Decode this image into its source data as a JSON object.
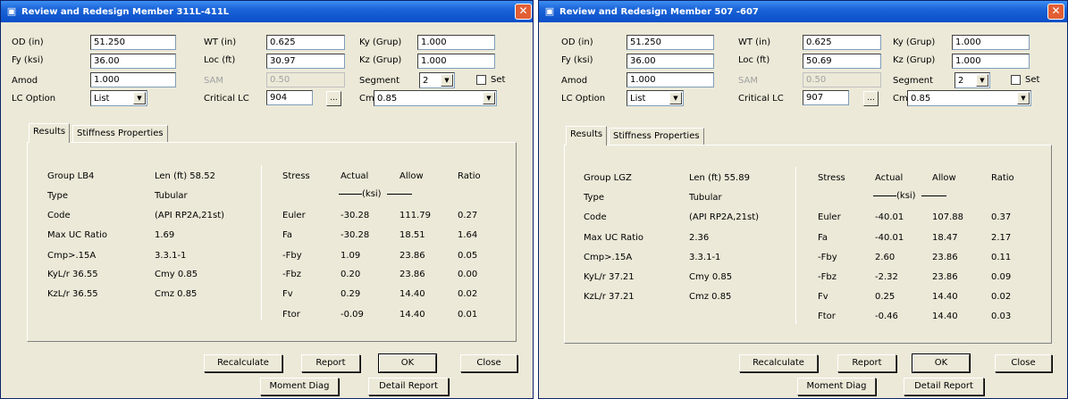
{
  "windows": [
    {
      "title": "Review and Redesign Member 311L-411L",
      "labels": {
        "od": "OD (in)",
        "fy": "Fy (ksi)",
        "amod": "Amod",
        "lc_option": "LC Option",
        "wt": "WT (in)",
        "loc": "Loc (ft)",
        "sam": "SAM",
        "critical_lc": "Critical LC",
        "ky": "Ky (Grup)",
        "kz": "Kz (Grup)",
        "segment": "Segment",
        "set": "Set",
        "cm": "Cm"
      },
      "values": {
        "od": "51.250",
        "fy": "36.00",
        "amod": "1.000",
        "lc_option": "List",
        "wt": "0.625",
        "loc": "30.97",
        "sam": "0.50",
        "critical_lc": "904",
        "ky": "1.000",
        "kz": "1.000",
        "segment": "2",
        "cm": "0.85",
        "ellipsis": "..."
      },
      "tabs": [
        "Results",
        "Stiffness Properties"
      ],
      "left_info": [
        [
          "Group LB4",
          "Len (ft) 58.52"
        ],
        [
          "Type",
          "Tubular"
        ],
        [
          "Code",
          "(API RP2A,21st)"
        ],
        [
          "Max UC Ratio",
          "1.69"
        ],
        [
          "Cmp>.15A",
          "3.3.1-1"
        ],
        [
          "KyL/r  36.55",
          "Cmy  0.85"
        ],
        [
          "KzL/r  36.55",
          "Cmz  0.85"
        ]
      ],
      "stress_headers": [
        "Stress",
        "Actual",
        "Allow",
        "Ratio"
      ],
      "ksi": "(ksi)",
      "stress_rows": [
        [
          "Euler",
          "-30.28",
          "111.79",
          "0.27"
        ],
        [
          "Fa",
          "-30.28",
          "18.51",
          "1.64"
        ],
        [
          "-Fby",
          "1.09",
          "23.86",
          "0.05"
        ],
        [
          "-Fbz",
          "0.20",
          "23.86",
          "0.00"
        ],
        [
          "Fv",
          "0.29",
          "14.40",
          "0.02"
        ],
        [
          "Ftor",
          "-0.09",
          "14.40",
          "0.01"
        ]
      ],
      "buttons": {
        "recalculate": "Recalculate",
        "report": "Report",
        "ok": "OK",
        "close": "Close",
        "moment_diag": "Moment Diag",
        "detail_report": "Detail Report"
      }
    },
    {
      "title": "Review and Redesign Member 507 -607",
      "labels": {
        "od": "OD (in)",
        "fy": "Fy (ksi)",
        "amod": "Amod",
        "lc_option": "LC Option",
        "wt": "WT (in)",
        "loc": "Loc (ft)",
        "sam": "SAM",
        "critical_lc": "Critical LC",
        "ky": "Ky (Grup)",
        "kz": "Kz (Grup)",
        "segment": "Segment",
        "set": "Set",
        "cm": "Cm"
      },
      "values": {
        "od": "51.250",
        "fy": "36.00",
        "amod": "1.000",
        "lc_option": "List",
        "wt": "0.625",
        "loc": "50.69",
        "sam": "0.50",
        "critical_lc": "907",
        "ky": "1.000",
        "kz": "1.000",
        "segment": "2",
        "cm": "0.85",
        "ellipsis": "..."
      },
      "tabs": [
        "Results",
        "Stiffness Properties"
      ],
      "left_info": [
        [
          "Group LGZ",
          "Len (ft) 55.89"
        ],
        [
          "Type",
          "Tubular"
        ],
        [
          "Code",
          "(API RP2A,21st)"
        ],
        [
          "Max UC Ratio",
          "2.36"
        ],
        [
          "Cmp>.15A",
          "3.3.1-1"
        ],
        [
          "KyL/r  37.21",
          "Cmy  0.85"
        ],
        [
          "KzL/r  37.21",
          "Cmz  0.85"
        ]
      ],
      "stress_headers": [
        "Stress",
        "Actual",
        "Allow",
        "Ratio"
      ],
      "ksi": "(ksi)",
      "stress_rows": [
        [
          "Euler",
          "-40.01",
          "107.88",
          "0.37"
        ],
        [
          "Fa",
          "-40.01",
          "18.47",
          "2.17"
        ],
        [
          "-Fby",
          "2.60",
          "23.86",
          "0.11"
        ],
        [
          "-Fbz",
          "-2.32",
          "23.86",
          "0.09"
        ],
        [
          "Fv",
          "0.25",
          "14.40",
          "0.02"
        ],
        [
          "Ftor",
          "-0.46",
          "14.40",
          "0.03"
        ]
      ],
      "buttons": {
        "recalculate": "Recalculate",
        "report": "Report",
        "ok": "OK",
        "close": "Close",
        "moment_diag": "Moment Diag",
        "detail_report": "Detail Report"
      }
    }
  ],
  "icons": {
    "title": "binoculars-icon",
    "close": "close-icon",
    "dropdown": "chevron-down-icon"
  },
  "colors": {
    "titlebar": "#0a4fc8",
    "close_button": "#e35e34",
    "dialog_bg": "#ece9d8"
  }
}
